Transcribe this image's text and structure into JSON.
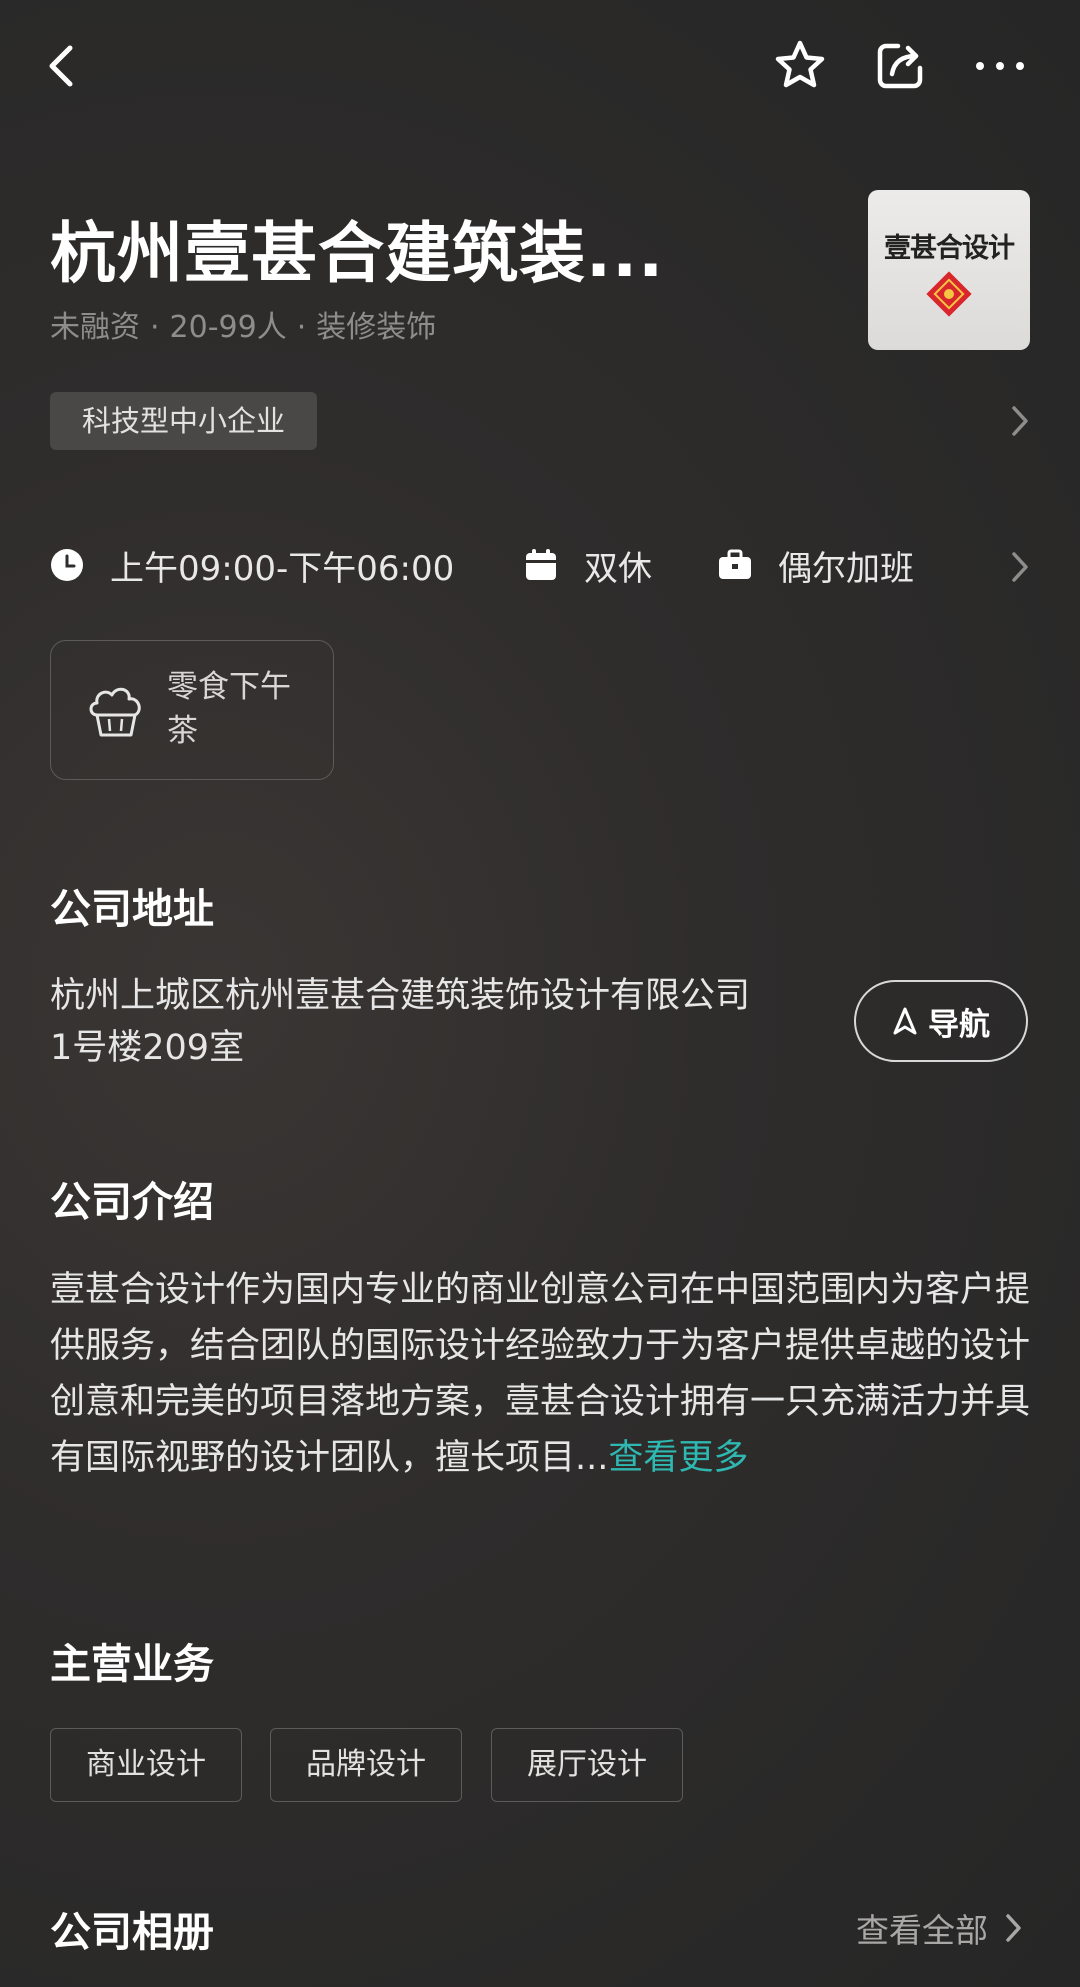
{
  "company": {
    "name": "杭州壹甚合建筑装...",
    "meta": [
      "未融资",
      "20-99人",
      "装修装饰"
    ],
    "logo_text": "壹甚合设计",
    "tag": "科技型中小企业"
  },
  "work": {
    "hours": "上午09:00-下午06:00",
    "rest": "双休",
    "overtime": "偶尔加班"
  },
  "benefit": {
    "label": "零食下午茶",
    "icon": "cupcake-icon"
  },
  "address": {
    "title": "公司地址",
    "line1": "杭州上城区杭州壹甚合建筑装饰设计有限公司",
    "line2": "1号楼209室",
    "nav_label": "导航"
  },
  "intro": {
    "title": "公司介绍",
    "text": "壹甚合设计作为国内专业的商业创意公司在中国范围内为客户提供服务，结合团队的国际设计经验致力于为客户提供卓越的设计创意和完美的项目落地方案，壹甚合设计拥有一只充满活力并具有国际视野的设计团队，擅长项目...",
    "more_label": "查看更多",
    "more_color": "#2eb8b1"
  },
  "business": {
    "title": "主营业务",
    "items": [
      "商业设计",
      "品牌设计",
      "展厅设计"
    ]
  },
  "album": {
    "title": "公司相册",
    "view_all": "查看全部"
  },
  "icons": {
    "back": "back-arrow-icon",
    "star": "star-icon",
    "share": "share-icon",
    "more": "more-dots-icon"
  }
}
